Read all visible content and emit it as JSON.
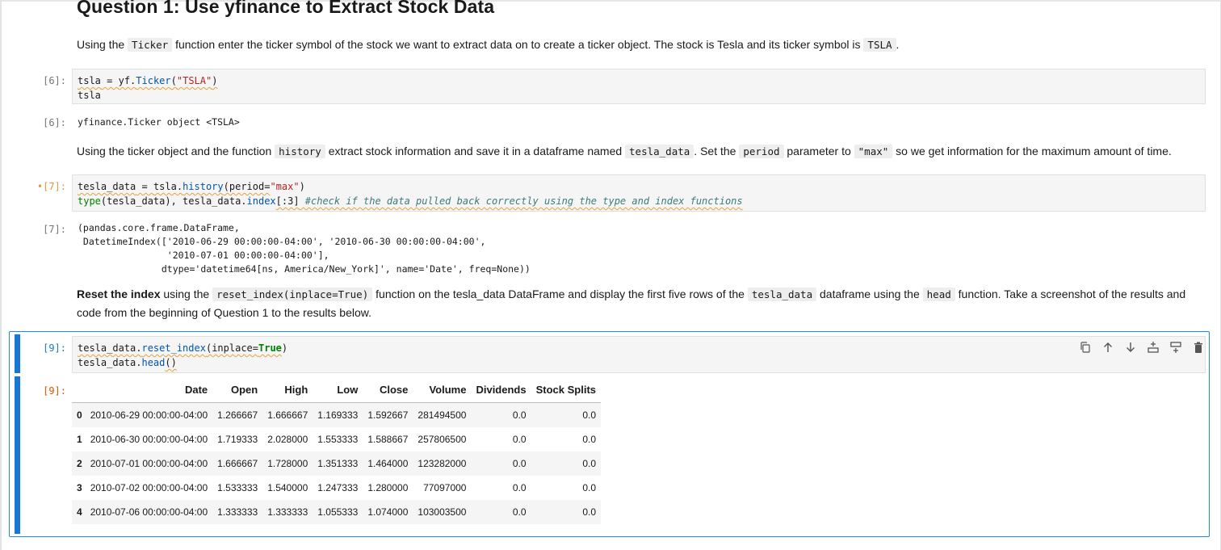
{
  "title": "Question 1: Use yfinance to Extract Stock Data",
  "intro": {
    "t1": "Using the ",
    "c1": "Ticker",
    "t2": " function enter the ticker symbol of the stock we want to extract data on to create a ticker object. The stock is Tesla and its ticker symbol is ",
    "c2": "TSLA",
    "t3": "."
  },
  "cell6": {
    "prompt_in": "[6]:",
    "prompt_out": "[6]:",
    "line1_a": "tsla",
    "line1_b": " = ",
    "line1_c": "yf.",
    "line1_d": "Ticker",
    "line1_e": "(",
    "line1_f": "\"TSLA\"",
    "line1_g": ")",
    "line2": "tsla",
    "output": "yfinance.Ticker object <TSLA>"
  },
  "md2": {
    "t1": "Using the ticker object and the function ",
    "c1": "history",
    "t2": " extract stock information and save it in a dataframe named ",
    "c2": "tesla_data",
    "t3": ". Set the ",
    "c3": "period",
    "t4": " parameter to ",
    "c4": "\"max\"",
    "t5": " so we get information for the maximum amount of time."
  },
  "cell7": {
    "prompt_in": "•[7]:",
    "prompt_out": "[7]:",
    "l1_a": "tesla_data",
    "l1_b": " = ",
    "l1_c": "tsla.",
    "l1_d": "history",
    "l1_e": "(period=",
    "l1_f": "\"max\"",
    "l1_g": ")",
    "l2_a": "type",
    "l2_b": "(tesla_data), tesla_data.",
    "l2_c": "index",
    "l2_d": "[:3]",
    "l2_e": " #check if the data pulled back correctly using the type and index functions",
    "output": "(pandas.core.frame.DataFrame,\n DatetimeIndex(['2010-06-29 00:00:00-04:00', '2010-06-30 00:00:00-04:00',\n                '2010-07-01 00:00:00-04:00'],\n               dtype='datetime64[ns, America/New_York]', name='Date', freq=None))"
  },
  "md3": {
    "b1": "Reset the index",
    "t1": " using the ",
    "c1": "reset_index(inplace=True)",
    "t2": " function on the tesla_data DataFrame and display the first five rows of the ",
    "c2": "tesla_data",
    "t3": " dataframe using the ",
    "c3": "head",
    "t4": " function. Take a screenshot of the results and code from the beginning of Question 1 to the results below."
  },
  "cell9": {
    "prompt_in": "[9]:",
    "prompt_out": "[9]:",
    "l1_a": "tesla_data.",
    "l1_b": "reset_index",
    "l1_c": "(inplace=",
    "l1_d": "True",
    "l1_e": ")",
    "l2_a": "tesla_data.",
    "l2_b": "head",
    "l2_c": "()"
  },
  "toolbar": [
    "duplicate-icon",
    "move-up-icon",
    "move-down-icon",
    "insert-above-icon",
    "insert-below-icon",
    "delete-icon"
  ],
  "table": {
    "columns": [
      "",
      "Date",
      "Open",
      "High",
      "Low",
      "Close",
      "Volume",
      "Dividends",
      "Stock Splits"
    ],
    "rows": [
      [
        "0",
        "2010-06-29 00:00:00-04:00",
        "1.266667",
        "1.666667",
        "1.169333",
        "1.592667",
        "281494500",
        "0.0",
        "0.0"
      ],
      [
        "1",
        "2010-06-30 00:00:00-04:00",
        "1.719333",
        "2.028000",
        "1.553333",
        "1.588667",
        "257806500",
        "0.0",
        "0.0"
      ],
      [
        "2",
        "2010-07-01 00:00:00-04:00",
        "1.666667",
        "1.728000",
        "1.351333",
        "1.464000",
        "123282000",
        "0.0",
        "0.0"
      ],
      [
        "3",
        "2010-07-02 00:00:00-04:00",
        "1.533333",
        "1.540000",
        "1.247333",
        "1.280000",
        "77097000",
        "0.0",
        "0.0"
      ],
      [
        "4",
        "2010-07-06 00:00:00-04:00",
        "1.333333",
        "1.333333",
        "1.055333",
        "1.074000",
        "103003500",
        "0.0",
        "0.0"
      ]
    ]
  },
  "colors": {
    "accent": "#1976d2",
    "busy": "#e09b3d",
    "string": "#ba2121",
    "keyword": "#008000",
    "comment": "#3d7a7a"
  }
}
